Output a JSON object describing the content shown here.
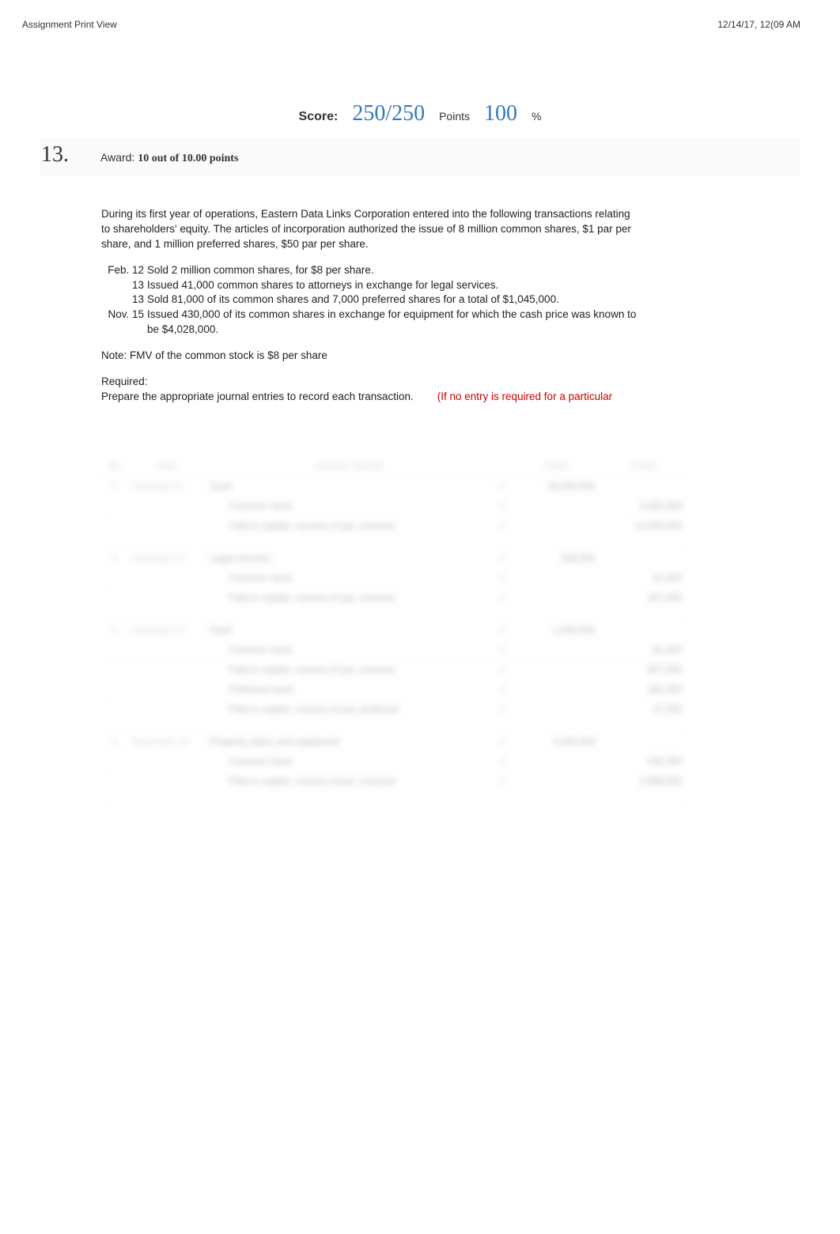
{
  "meta": {
    "left": "Assignment Print View",
    "right": "12/14/17, 12(09 AM"
  },
  "score": {
    "label": "Score:",
    "value": "250/250",
    "points_label": "Points",
    "percent": "100",
    "percent_sign": "%"
  },
  "question": {
    "number": "13.",
    "award_prefix": "Award: ",
    "award_bold": "10 out of 10.00 points",
    "award_overlay": "10.00 points"
  },
  "problem": {
    "intro": "During its first year of operations, Eastern Data Links Corporation entered into the following transactions relating to shareholders' equity. The articles of incorporation authorized the issue of 8 million common shares, $1 par per share, and 1 million preferred shares, $50 par per share.",
    "transactions": [
      {
        "date": "Feb. 12",
        "text": "Sold 2 million common shares, for $8 per share."
      },
      {
        "date": "13",
        "text": "Issued 41,000 common shares to attorneys in exchange for legal services."
      },
      {
        "date": "13",
        "text": "Sold 81,000 of its common shares and 7,000 preferred shares for a total of $1,045,000."
      },
      {
        "date": "Nov. 15",
        "text": "Issued 430,000 of its common shares in exchange for equipment for which the cash price was known to be $4,028,000."
      }
    ],
    "note": "Note: FMV of the common stock is $8 per share",
    "required_label": "Required:",
    "required_text": "Prepare the appropriate journal entries to record each transaction.",
    "required_hint": "(If no entry is required for a particular"
  },
  "table": {
    "headers": {
      "no": "No",
      "date": "Date",
      "gj": "General Journal",
      "debit": "Debit",
      "credit": "Credit"
    },
    "entries": [
      {
        "no": "1",
        "date": "February 12",
        "lines": [
          {
            "acct": "Cash",
            "indent": false,
            "debit": "16,000,000",
            "credit": ""
          },
          {
            "acct": "Common stock",
            "indent": true,
            "debit": "",
            "credit": "2,000,000"
          },
          {
            "acct": "Paid-in capital—excess of par, common",
            "indent": true,
            "debit": "",
            "credit": "14,000,000"
          }
        ]
      },
      {
        "no": "2",
        "date": "February 13",
        "lines": [
          {
            "acct": "Legal services",
            "indent": false,
            "debit": "328,000",
            "credit": ""
          },
          {
            "acct": "Common stock",
            "indent": true,
            "debit": "",
            "credit": "41,000"
          },
          {
            "acct": "Paid-in capital—excess of par, common",
            "indent": true,
            "debit": "",
            "credit": "287,000"
          }
        ]
      },
      {
        "no": "3",
        "date": "February 13",
        "lines": [
          {
            "acct": "Cash",
            "indent": false,
            "debit": "1,045,000",
            "credit": ""
          },
          {
            "acct": "Common stock",
            "indent": true,
            "debit": "",
            "credit": "81,000"
          },
          {
            "acct": "Paid-in capital—excess of par, common",
            "indent": true,
            "debit": "",
            "credit": "567,000"
          },
          {
            "acct": "Preferred stock",
            "indent": true,
            "debit": "",
            "credit": "350,000"
          },
          {
            "acct": "Paid-in capital—excess of par, preferred",
            "indent": true,
            "debit": "",
            "credit": "47,000"
          }
        ]
      },
      {
        "no": "4",
        "date": "November 15",
        "lines": [
          {
            "acct": "Property, plant, and equipment",
            "indent": false,
            "debit": "4,028,000",
            "credit": ""
          },
          {
            "acct": "Common stock",
            "indent": true,
            "debit": "",
            "credit": "430,000"
          },
          {
            "acct": "Paid-in capital—excess of par, common",
            "indent": true,
            "debit": "",
            "credit": "3,598,000"
          }
        ]
      }
    ]
  },
  "icons": {
    "check": "✔"
  }
}
